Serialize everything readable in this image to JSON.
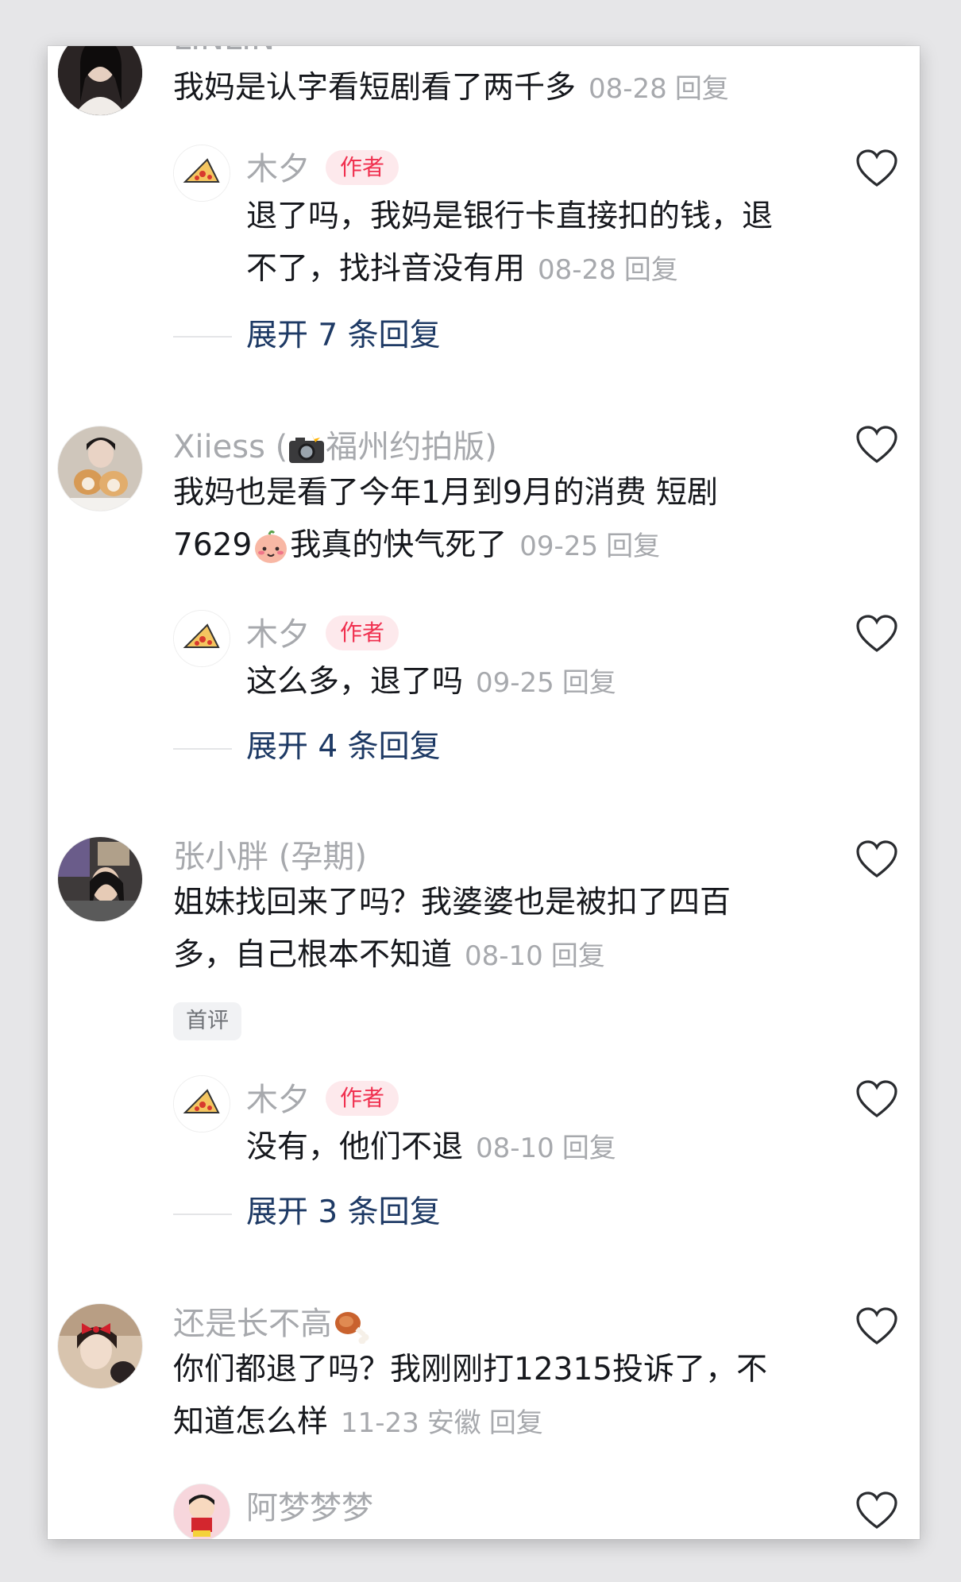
{
  "comments": [
    {
      "username": "LINLIN",
      "text": "我妈是认字看短剧看了两千多",
      "date": "08-28",
      "reply_label": "回复",
      "replies": [
        {
          "username": "木夕",
          "badge": "作者",
          "line1": "退了吗，我妈是银行卡直接扣的钱，退",
          "line2": "不了，找抖音没有用",
          "date": "08-28",
          "reply_label": "回复"
        }
      ],
      "expand_label": "展开 7 条回复"
    },
    {
      "username_prefix": "Xiiess (",
      "username_suffix": "福州约拍版)",
      "line1": "我妈也是看了今年1月到9月的消费 短剧",
      "line2_start": "7629",
      "line2_end": "我真的快气死了",
      "date": "09-25",
      "reply_label": "回复",
      "replies": [
        {
          "username": "木夕",
          "badge": "作者",
          "text": "这么多，退了吗",
          "date": "09-25",
          "reply_label": "回复"
        }
      ],
      "expand_label": "展开 4 条回复"
    },
    {
      "username": "张小胖 (孕期)",
      "line1": "姐妹找回来了吗？我婆婆也是被扣了四百",
      "line2": "多，自己根本不知道",
      "date": "08-10",
      "reply_label": "回复",
      "tag": "首评",
      "replies": [
        {
          "username": "木夕",
          "badge": "作者",
          "text": "没有，他们不退",
          "date": "08-10",
          "reply_label": "回复"
        }
      ],
      "expand_label": "展开 3 条回复"
    },
    {
      "username": "还是长不高",
      "line1": "你们都退了吗？我刚刚打12315投诉了，不",
      "line2": "知道怎么样",
      "date": "11-23",
      "location": "安徽",
      "reply_label": "回复",
      "replies": [
        {
          "username": "阿梦梦梦"
        }
      ]
    }
  ],
  "icons": {
    "like": "heart-outline-icon",
    "collapse": "chevron-down-icon",
    "camera": "camera-flash-emoji",
    "blush": "blushing-face-emoji",
    "meat": "meat-on-bone-emoji"
  },
  "colors": {
    "author_badge": "#f0304f",
    "expand_link": "#1e3a65",
    "meta": "#a7a9ad"
  }
}
